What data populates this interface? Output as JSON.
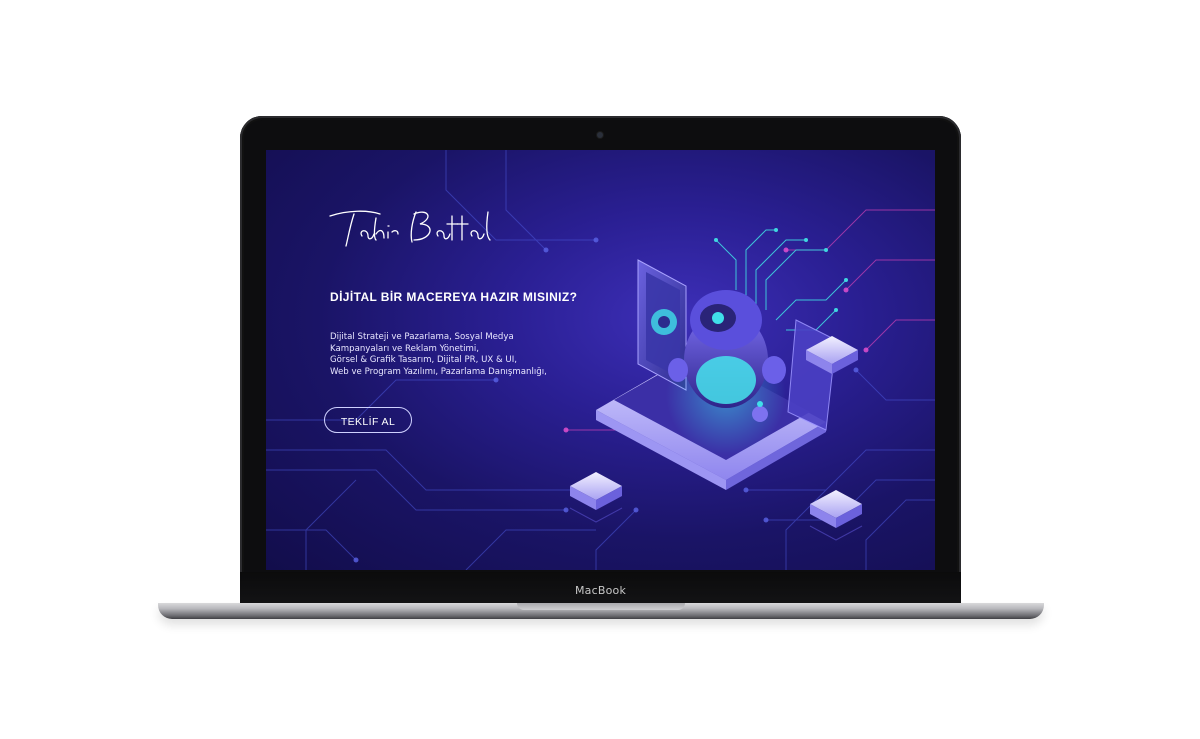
{
  "device": {
    "brand_label": "MacBook"
  },
  "page": {
    "signature_text": "Tahir Battal",
    "headline": "DİJİTAL BİR MACEREYA HAZIR MISINIZ?",
    "services": [
      "Dijital Strateji ve Pazarlama, Sosyal Medya",
      "Kampanyaları ve Reklam Yönetimi,",
      "Görsel & Grafik Tasarım, Dijital PR, UX & UI,",
      "Web ve Program Yazılımı, Pazarlama Danışmanlığı,"
    ],
    "cta_label": "TEKLİF AL"
  },
  "colors": {
    "screen_bg": "#1a1466",
    "accent_cyan": "#3fd6e0",
    "accent_magenta": "#c03fb0",
    "text": "#ffffff"
  },
  "icons": {
    "hero_illustration": "isometric-robot-laptop-illustration",
    "signature": "handwritten-signature-logo"
  }
}
